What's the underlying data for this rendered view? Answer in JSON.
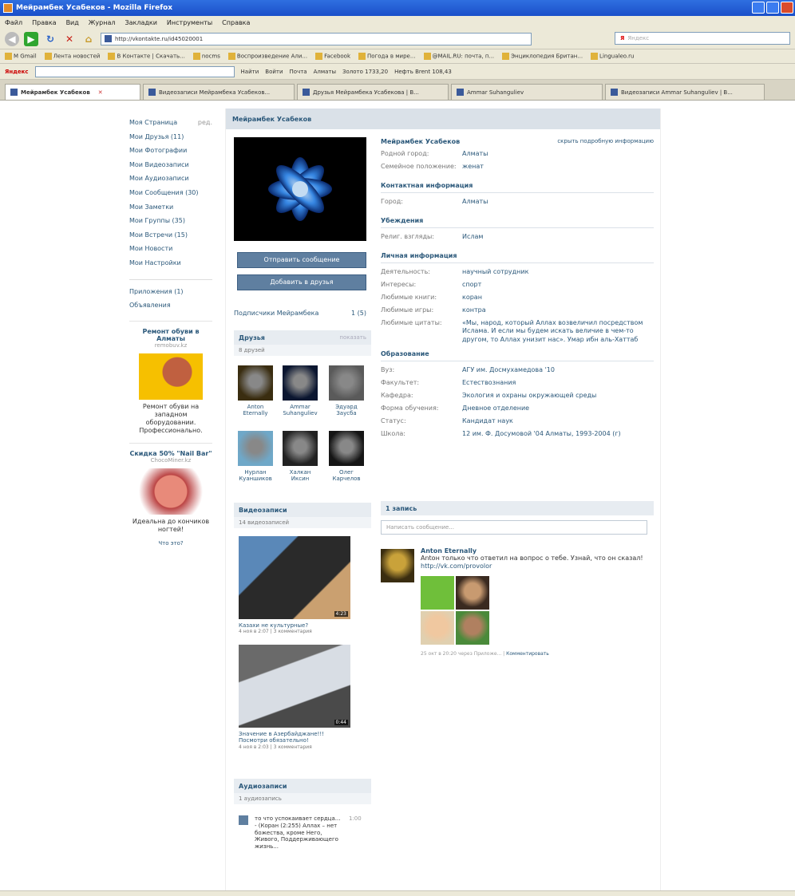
{
  "browser": {
    "title": "Мейрамбек Усабеков - Mozilla Firefox",
    "menu": [
      "Файл",
      "Правка",
      "Вид",
      "Журнал",
      "Закладки",
      "Инструменты",
      "Справка"
    ],
    "url": "http://vkontakte.ru/id45020001",
    "bookmarks": [
      "M Gmail",
      "Лента новостей",
      "В Контакте | Скачать...",
      "nocms",
      "Воспроизведение Али...",
      "Facebook",
      "Погода в мире...",
      "@MAIL.RU: почта, п...",
      "Энциклопедия Британ...",
      "Lingualeo.ru"
    ],
    "yandex_toolbar": [
      "Яндекс",
      "Найти",
      "Войти",
      "Почта",
      "Алматы",
      "Золото 1733,20",
      "Нефть Brent 108,43"
    ],
    "tabs": [
      {
        "label": "Мейрамбек Усабеков",
        "active": true
      },
      {
        "label": "Видеозаписи Мейрамбека Усабеков...",
        "active": false
      },
      {
        "label": "Друзья Мейрамбека Усабекова | В...",
        "active": false
      },
      {
        "label": "Ammar Suhanguliev",
        "active": false
      },
      {
        "label": "Видеозаписи Ammar Suhanguliev | В...",
        "active": false
      }
    ],
    "search_placeholder": "Яндекс"
  },
  "leftnav": {
    "items": [
      "Моя Страница",
      "Мои Друзья (11)",
      "Мои Фотографии",
      "Мои Видеозаписи",
      "Мои Аудиозаписи",
      "Мои Сообщения (30)",
      "Мои Заметки",
      "Мои Группы (35)",
      "Мои Встречи (15)",
      "Мои Новости",
      "Мои Настройки"
    ],
    "edit": "ред.",
    "extra": [
      "Приложения (1)",
      "Объявления"
    ],
    "ads": [
      {
        "title": "Ремонт обуви в Алматы",
        "domain": "remobuv.kz",
        "text": "Ремонт обуви на западном оборудовании. Профессионально."
      },
      {
        "title": "Скидка 50% \"Nail Bar\"",
        "domain": "ChocoMiner.kz",
        "text": "Идеальна до кончиков ногтей!"
      }
    ],
    "ads_more": "Что это?"
  },
  "page": {
    "head": "Мейрамбек Усабеков",
    "send_message": "Отправить сообщение",
    "add_friend": "Добавить в друзья",
    "subscribers_label": "Подписчики Мейрамбека",
    "subscribers_count": "1 (5)",
    "friends": {
      "title": "Друзья",
      "right": "показать",
      "count": "8 друзей",
      "items": [
        {
          "name": "Anton Eternally",
          "color": "#3a2d10"
        },
        {
          "name": "Ammar Suhanguliev",
          "color": "#0b1630"
        },
        {
          "name": "Эдуард Заусба",
          "color": "#5a5a5a"
        },
        {
          "name": "Нурлан Куаншиков",
          "color": "#6fa8c8"
        },
        {
          "name": "Халкан Иксин",
          "color": "#222222"
        },
        {
          "name": "Олег Карчелов",
          "color": "#151515"
        }
      ]
    },
    "videos": {
      "title": "Видеозаписи",
      "count": "14 видеозаписей",
      "items": [
        {
          "title": "Казахи не культурные?",
          "meta": "4 ноя в 2:07 | 3 комментария",
          "duration": "4:23"
        },
        {
          "title": "Значение в Азербайджане!!!Посмотри обязательно!",
          "meta": "4 ноя в 2:03 | 3 комментария",
          "duration": "0:44"
        }
      ]
    },
    "audio": {
      "title": "Аудиозаписи",
      "count": "1 аудиозапись",
      "track": "то что успокаивает сердца... - (Коран (2:255) Аллах – нет божества, кроме Него, Живого, Поддерживающего жизнь...",
      "duration": "1:00"
    }
  },
  "profile": {
    "name": "Мейрамбек Усабеков",
    "hide_link": "скрыть подробную информацию",
    "basic": [
      {
        "k": "Родной город:",
        "v": "Алматы"
      },
      {
        "k": "Семейное положение:",
        "v": "женат"
      }
    ],
    "contacts_title": "Контактная информация",
    "contacts": [
      {
        "k": "Город:",
        "v": "Алматы"
      }
    ],
    "beliefs_title": "Убеждения",
    "beliefs": [
      {
        "k": "Религ. взгляды:",
        "v": "Ислам"
      }
    ],
    "personal_title": "Личная информация",
    "personal": [
      {
        "k": "Деятельность:",
        "v": "научный сотрудник"
      },
      {
        "k": "Интересы:",
        "v": "спорт"
      },
      {
        "k": "Любимые книги:",
        "v": "коран"
      },
      {
        "k": "Любимые игры:",
        "v": "контра"
      },
      {
        "k": "Любимые цитаты:",
        "v": "«Мы, народ, который Аллах возвеличил посредством Ислама. И если мы будем искать величие в чем-то другом, то Аллах унизит нас». Умар ибн аль-Хаттаб"
      }
    ],
    "education_title": "Образование",
    "education": [
      {
        "k": "Вуз:",
        "v": "АГУ им. Досмухамедова '10"
      },
      {
        "k": "Факультет:",
        "v": "Естествознания"
      },
      {
        "k": "Кафедра:",
        "v": "Экология и охраны окружающей среды"
      },
      {
        "k": "Форма обучения:",
        "v": "Дневное отделение"
      },
      {
        "k": "Статус:",
        "v": "Кандидат наук"
      },
      {
        "k": "Школа:",
        "v": "12 им. Ф. Досумовой '04 Алматы, 1993-2004 (г)"
      }
    ]
  },
  "wall": {
    "title": "1 запись",
    "placeholder": "Написать сообщение...",
    "post": {
      "author": "Anton Eternally",
      "text": "Antoн только что ответил на вопрос о тебе. Узнай, что он сказал!",
      "link": "http://vk.com/provolor",
      "meta": "25 окт в 20:20 через Приложе...",
      "comment": "Комментировать"
    }
  }
}
